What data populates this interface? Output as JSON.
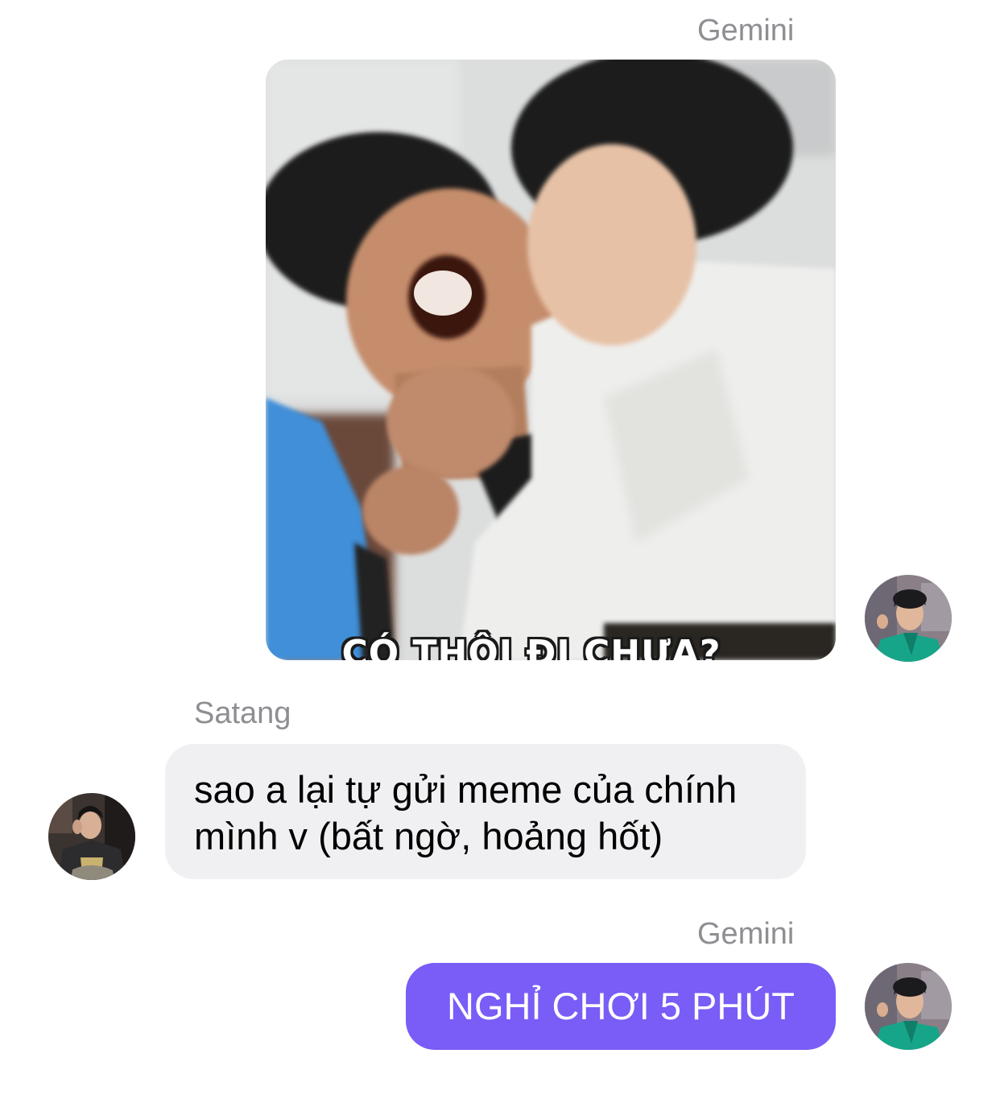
{
  "colors": {
    "incoming_bubble": "#f0f0f2",
    "outgoing_bubble": "#7a5cf7",
    "sender_name": "#8e8e93"
  },
  "messages": [
    {
      "sender": "Gemini",
      "direction": "outgoing",
      "type": "image",
      "image_caption": "CÓ THÔI ĐI CHƯA?",
      "avatar": "gemini-avatar"
    },
    {
      "sender": "Satang",
      "direction": "incoming",
      "type": "text",
      "text": "sao a lại tự gửi meme của chính mình v (bất ngờ, hoảng hốt)",
      "avatar": "satang-avatar"
    },
    {
      "sender": "Gemini",
      "direction": "outgoing",
      "type": "text",
      "text": "NGHỈ CHƠI 5 PHÚT",
      "avatar": "gemini-avatar"
    }
  ]
}
